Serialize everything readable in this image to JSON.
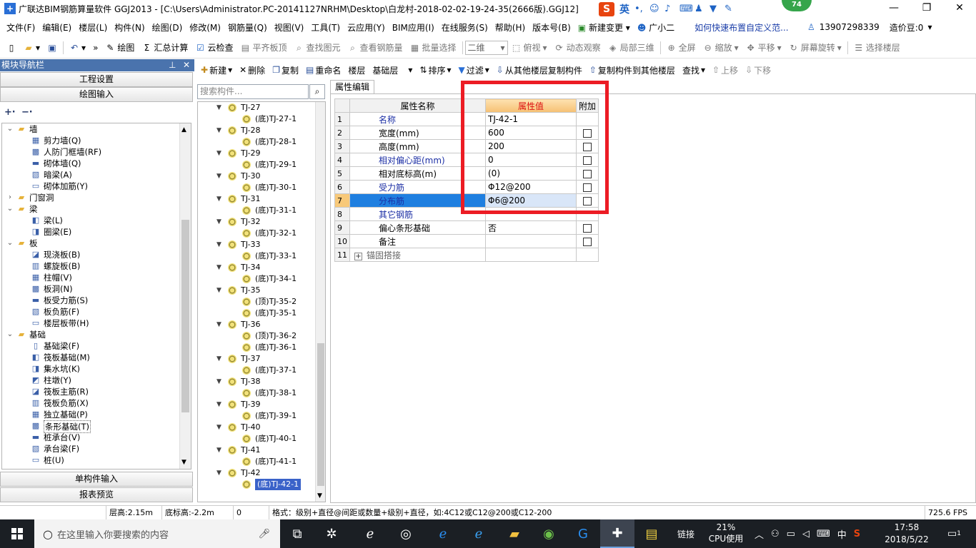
{
  "window": {
    "title": "广联达BIM钢筋算量软件 GGJ2013 - [C:\\Users\\Administrator.PC-20141127NRHM\\Desktop\\白龙村-2018-02-02-19-24-35(2666版).GGJ12]",
    "ime_label": "英",
    "badge_count": "74"
  },
  "menu": {
    "items": [
      "文件(F)",
      "编辑(E)",
      "楼层(L)",
      "构件(N)",
      "绘图(D)",
      "修改(M)",
      "钢筋量(Q)",
      "视图(V)",
      "工具(T)",
      "云应用(Y)",
      "BIM应用(I)",
      "在线服务(S)",
      "帮助(H)",
      "版本号(B)"
    ],
    "new_change": "新建变更",
    "guangxiaoer": "广小二",
    "tip_link": "如何快速布置自定义范...",
    "phone": "13907298339",
    "zaojia": "造价豆:0"
  },
  "toolbar": {
    "draw": "绘图",
    "sum": "汇总计算",
    "cloud_check": "云检查",
    "level_slab_top": "平齐板顶",
    "find_element": "查找图元",
    "view_rebar": "查看钢筋量",
    "batch_select": "批量选择",
    "view_mode": "二维",
    "top_view": "俯视",
    "dynamic_view": "动态观察",
    "local_3d": "局部三维",
    "fullscreen": "全屏",
    "zoom": "缩放",
    "pan": "平移",
    "rotate": "屏幕旋转",
    "select_floor": "选择楼层"
  },
  "nav": {
    "header": "模块导航栏",
    "project_settings": "工程设置",
    "drawing_input": "绘图输入",
    "single_input": "单构件输入",
    "report_preview": "报表预览",
    "tree": [
      {
        "label": "墙",
        "level": 0,
        "expanded": true,
        "folder": true
      },
      {
        "label": "剪力墙(Q)",
        "level": 1
      },
      {
        "label": "人防门框墙(RF)",
        "level": 1
      },
      {
        "label": "砌体墙(Q)",
        "level": 1
      },
      {
        "label": "暗梁(A)",
        "level": 1
      },
      {
        "label": "砌体加筋(Y)",
        "level": 1
      },
      {
        "label": "门窗洞",
        "level": 0,
        "expanded": false,
        "folder": true
      },
      {
        "label": "梁",
        "level": 0,
        "expanded": true,
        "folder": true
      },
      {
        "label": "梁(L)",
        "level": 1
      },
      {
        "label": "圈梁(E)",
        "level": 1
      },
      {
        "label": "板",
        "level": 0,
        "expanded": true,
        "folder": true
      },
      {
        "label": "现浇板(B)",
        "level": 1
      },
      {
        "label": "螺旋板(B)",
        "level": 1
      },
      {
        "label": "柱帽(V)",
        "level": 1
      },
      {
        "label": "板洞(N)",
        "level": 1
      },
      {
        "label": "板受力筋(S)",
        "level": 1
      },
      {
        "label": "板负筋(F)",
        "level": 1
      },
      {
        "label": "楼层板带(H)",
        "level": 1
      },
      {
        "label": "基础",
        "level": 0,
        "expanded": true,
        "folder": true
      },
      {
        "label": "基础梁(F)",
        "level": 1
      },
      {
        "label": "筏板基础(M)",
        "level": 1
      },
      {
        "label": "集水坑(K)",
        "level": 1
      },
      {
        "label": "柱墩(Y)",
        "level": 1
      },
      {
        "label": "筏板主筋(R)",
        "level": 1
      },
      {
        "label": "筏板负筋(X)",
        "level": 1
      },
      {
        "label": "独立基础(P)",
        "level": 1
      },
      {
        "label": "条形基础(T)",
        "level": 1,
        "selected": true
      },
      {
        "label": "桩承台(V)",
        "level": 1
      },
      {
        "label": "承台梁(F)",
        "level": 1
      },
      {
        "label": "桩(U)",
        "level": 1
      }
    ]
  },
  "gridtoolbar": {
    "new": "新建",
    "delete": "删除",
    "copy": "复制",
    "rename": "重命名",
    "floor_label": "楼层",
    "floor_value": "基础层",
    "sort": "排序",
    "filter": "过滤",
    "copy_from": "从其他楼层复制构件",
    "copy_to": "复制构件到其他楼层",
    "find": "查找",
    "move_up": "上移",
    "move_down": "下移"
  },
  "search": {
    "placeholder": "搜索构件..."
  },
  "comptree": [
    {
      "label": "TJ-27",
      "level": 0
    },
    {
      "label": "(底)TJ-27-1",
      "level": 1
    },
    {
      "label": "TJ-28",
      "level": 0
    },
    {
      "label": "(底)TJ-28-1",
      "level": 1
    },
    {
      "label": "TJ-29",
      "level": 0
    },
    {
      "label": "(底)TJ-29-1",
      "level": 1
    },
    {
      "label": "TJ-30",
      "level": 0
    },
    {
      "label": "(底)TJ-30-1",
      "level": 1
    },
    {
      "label": "TJ-31",
      "level": 0
    },
    {
      "label": "(底)TJ-31-1",
      "level": 1
    },
    {
      "label": "TJ-32",
      "level": 0
    },
    {
      "label": "(底)TJ-32-1",
      "level": 1
    },
    {
      "label": "TJ-33",
      "level": 0
    },
    {
      "label": "(底)TJ-33-1",
      "level": 1
    },
    {
      "label": "TJ-34",
      "level": 0
    },
    {
      "label": "(底)TJ-34-1",
      "level": 1
    },
    {
      "label": "TJ-35",
      "level": 0
    },
    {
      "label": "(顶)TJ-35-2",
      "level": 1
    },
    {
      "label": "(底)TJ-35-1",
      "level": 1
    },
    {
      "label": "TJ-36",
      "level": 0
    },
    {
      "label": "(顶)TJ-36-2",
      "level": 1
    },
    {
      "label": "(底)TJ-36-1",
      "level": 1
    },
    {
      "label": "TJ-37",
      "level": 0
    },
    {
      "label": "(底)TJ-37-1",
      "level": 1
    },
    {
      "label": "TJ-38",
      "level": 0
    },
    {
      "label": "(底)TJ-38-1",
      "level": 1
    },
    {
      "label": "TJ-39",
      "level": 0
    },
    {
      "label": "(底)TJ-39-1",
      "level": 1
    },
    {
      "label": "TJ-40",
      "level": 0
    },
    {
      "label": "(底)TJ-40-1",
      "level": 1
    },
    {
      "label": "TJ-41",
      "level": 0
    },
    {
      "label": "(底)TJ-41-1",
      "level": 1
    },
    {
      "label": "TJ-42",
      "level": 0
    },
    {
      "label": "(底)TJ-42-1",
      "level": 1,
      "selected": true
    }
  ],
  "props": {
    "tab": "属性编辑",
    "headers": {
      "name": "属性名称",
      "value": "属性值",
      "extra": "附加"
    },
    "rows": [
      {
        "n": "1",
        "name": "名称",
        "value": "TJ-42-1",
        "blue": true,
        "checkbox": false
      },
      {
        "n": "2",
        "name": "宽度(mm)",
        "value": "600",
        "blue": false,
        "checkbox": true
      },
      {
        "n": "3",
        "name": "高度(mm)",
        "value": "200",
        "blue": false,
        "checkbox": true
      },
      {
        "n": "4",
        "name": "相对偏心距(mm)",
        "value": "0",
        "blue": true,
        "checkbox": true
      },
      {
        "n": "5",
        "name": "相对底标高(m)",
        "value": "(0)",
        "blue": false,
        "checkbox": true
      },
      {
        "n": "6",
        "name": "受力筋",
        "value": "Φ12@200",
        "blue": true,
        "checkbox": true
      },
      {
        "n": "7",
        "name": "分布筋",
        "value": "Φ6@200",
        "blue": true,
        "checkbox": true,
        "selected": true
      },
      {
        "n": "8",
        "name": "其它钢筋",
        "value": "",
        "blue": true,
        "checkbox": false
      },
      {
        "n": "9",
        "name": "偏心条形基础",
        "value": "否",
        "blue": false,
        "checkbox": true
      },
      {
        "n": "10",
        "name": "备注",
        "value": "",
        "blue": false,
        "checkbox": true
      },
      {
        "n": "11",
        "name": "锚固搭接",
        "value": "",
        "blue": false,
        "checkbox": false,
        "group": true
      }
    ]
  },
  "status": {
    "floor_height": "层高:2.15m",
    "bottom_elev": "底标高:-2.2m",
    "zero": "0",
    "format_hint": "格式：级别+直径@间距或数量+级别+直径，如:4C12或C12@200或C12-200",
    "fps": "725.6 FPS"
  },
  "taskbar": {
    "search_placeholder": "在这里输入你要搜索的内容",
    "link_label": "链接",
    "cpu_percent": "21%",
    "cpu_label": "CPU使用",
    "ime": "中",
    "time": "17:58",
    "date": "2018/5/22",
    "notif": "1"
  },
  "colors": {
    "accent_blue": "#1f7fe0",
    "highlight_red": "#ec1c24",
    "nav_header": "#4a73ad"
  }
}
